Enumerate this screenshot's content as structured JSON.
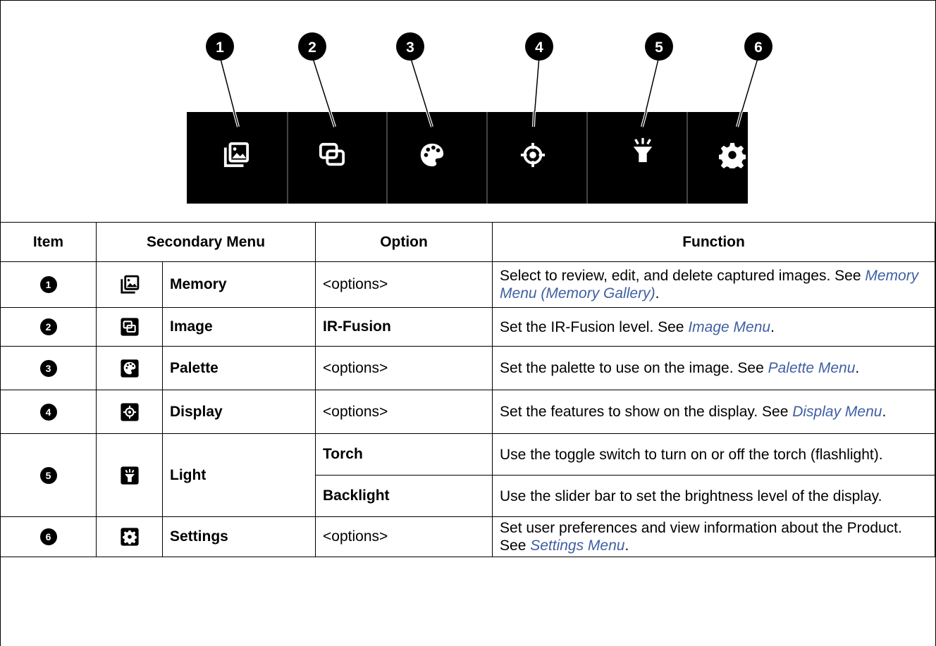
{
  "callouts": [
    "1",
    "2",
    "3",
    "4",
    "5",
    "6"
  ],
  "menu_bar": {
    "icons": [
      "memory-icon",
      "image-icon",
      "palette-icon",
      "display-icon",
      "light-icon",
      "settings-icon"
    ],
    "background": "#000000",
    "icon_color": "#ffffff"
  },
  "table": {
    "headers": {
      "item": "Item",
      "secondary_menu": "Secondary Menu",
      "option": "Option",
      "function": "Function"
    },
    "rows": [
      {
        "num": "1",
        "icon": "memory-icon",
        "name": "Memory",
        "option": "<options>",
        "function_text": "Select to review, edit, and delete captured images. See ",
        "function_link": "Memory Menu (Memory Gallery)",
        "function_end": "."
      },
      {
        "num": "2",
        "icon": "image-icon",
        "name": "Image",
        "option": "IR-Fusion",
        "function_text": "Set the IR-Fusion level. See ",
        "function_link": "Image Menu",
        "function_end": "."
      },
      {
        "num": "3",
        "icon": "palette-icon",
        "name": "Palette",
        "option": "<options>",
        "function_text": "Set the palette to use on the image. See ",
        "function_link": "Palette Menu",
        "function_end": "."
      },
      {
        "num": "4",
        "icon": "display-icon",
        "name": "Display",
        "option": "<options>",
        "function_text": "Set the features to show on the display. See ",
        "function_link": "Display Menu",
        "function_end": "."
      },
      {
        "num": "5",
        "icon": "light-icon",
        "name": "Light",
        "options": [
          {
            "option": "Torch",
            "function_text": "Use the toggle switch to turn on or off the torch (flashlight)."
          },
          {
            "option": "Backlight",
            "function_text": "Use the slider bar to set the brightness level of the display."
          }
        ]
      },
      {
        "num": "6",
        "icon": "settings-icon",
        "name": "Settings",
        "option": "<options>",
        "function_text": "Set user preferences and view information about the Product. See ",
        "function_link": "Settings Menu",
        "function_end": "."
      }
    ],
    "link_color": "#3f5fa3"
  }
}
